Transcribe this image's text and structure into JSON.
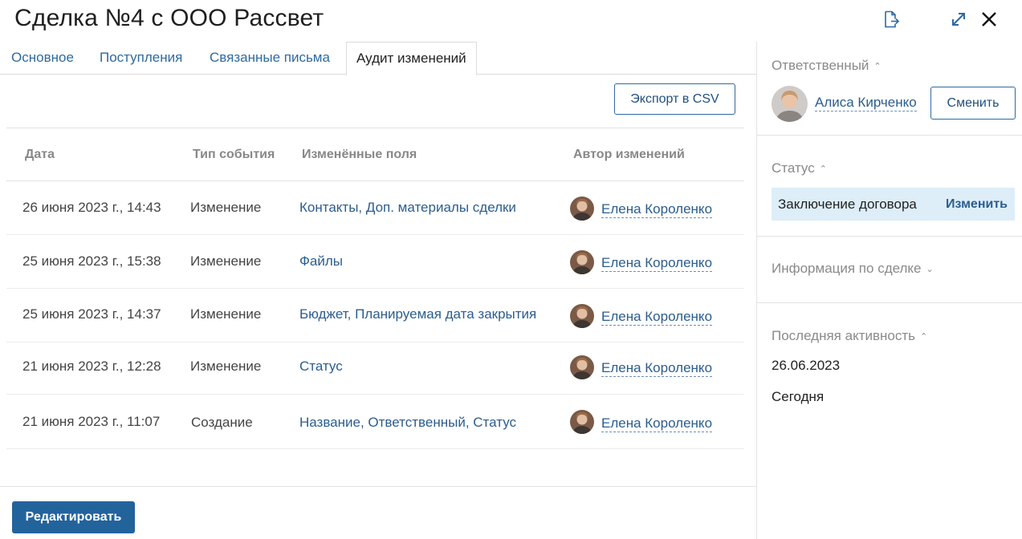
{
  "header": {
    "title": "Сделка №4 с ООО Рассвет",
    "icons": [
      "export-icon",
      "expand-icon",
      "close-icon"
    ]
  },
  "tabs": [
    {
      "label": "Основное"
    },
    {
      "label": "Поступления"
    },
    {
      "label": "Связанные письма"
    },
    {
      "label": "Аудит изменений",
      "active": true
    }
  ],
  "toolbar": {
    "export_label": "Экспорт в CSV"
  },
  "table": {
    "columns": [
      "Дата",
      "Тип события",
      "Изменённые поля",
      "Автор изменений"
    ],
    "rows": [
      {
        "date": "26 июня 2023 г., 14:43",
        "type": "Изменение",
        "fields": "Контакты, Доп. материалы сделки",
        "author": "Елена Короленко"
      },
      {
        "date": "25 июня 2023 г., 15:38",
        "type": "Изменение",
        "fields": "Файлы",
        "author": "Елена Короленко"
      },
      {
        "date": "25 июня 2023 г., 14:37",
        "type": "Изменение",
        "fields": "Бюджет, Планируемая дата закрытия",
        "author": "Елена Короленко"
      },
      {
        "date": "21 июня 2023 г., 12:28",
        "type": "Изменение",
        "fields": "Статус",
        "author": "Елена Короленко"
      },
      {
        "date": "21 июня 2023 г., 11:07",
        "type": "Создание",
        "fields": "Название, Ответственный, Статус",
        "author": "Елена Короленко"
      }
    ]
  },
  "footer": {
    "edit_label": "Редактировать"
  },
  "sidebar": {
    "responsible": {
      "heading": "Ответственный",
      "name": "Алиса Кирченко",
      "change_label": "Сменить"
    },
    "status": {
      "heading": "Статус",
      "value": "Заключение договора",
      "change_label": "Изменить"
    },
    "deal_info": {
      "heading": "Информация по сделке"
    },
    "last_activity": {
      "heading": "Последняя активность",
      "date": "26.06.2023",
      "relative": "Сегодня"
    }
  },
  "colors": {
    "accent": "#23639c",
    "link": "#2b5d8f",
    "status_bg": "#ddeef8"
  }
}
